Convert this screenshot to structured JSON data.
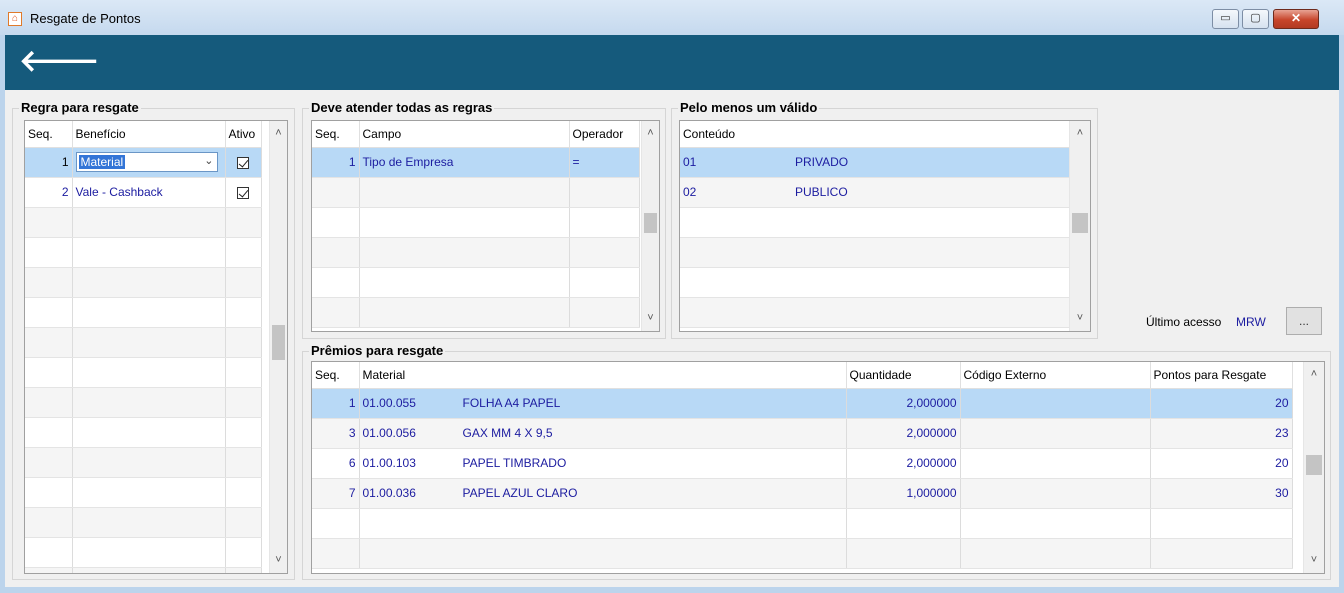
{
  "window": {
    "title": "Resgate de Pontos",
    "app_icon_glyph": "⌂",
    "min_glyph": "▭",
    "max_glyph": "▢",
    "close_glyph": "✕"
  },
  "toolbar": {
    "back_glyph": "🡐"
  },
  "regra": {
    "title": "Regra para resgate",
    "headers": {
      "seq": "Seq.",
      "beneficio": "Benefício",
      "ativo": "Ativo"
    },
    "rows": [
      {
        "seq": "1",
        "beneficio": "Material",
        "ativo": true
      },
      {
        "seq": "2",
        "beneficio": "Vale - Cashback",
        "ativo": true
      }
    ]
  },
  "deve": {
    "title": "Deve atender todas as regras",
    "headers": {
      "seq": "Seq.",
      "campo": "Campo",
      "operador": "Operador"
    },
    "rows": [
      {
        "seq": "1",
        "campo": "Tipo de Empresa",
        "operador": "="
      }
    ]
  },
  "pelo": {
    "title": "Pelo menos um válido",
    "headers": {
      "conteudo": "Conteúdo"
    },
    "rows": [
      {
        "codigo": "01",
        "descricao": "PRIVADO"
      },
      {
        "codigo": "02",
        "descricao": "PUBLICO"
      }
    ]
  },
  "ultimo_acesso": {
    "label": "Último acesso",
    "user": "MRW",
    "button": "..."
  },
  "premios": {
    "title": "Prêmios para resgate",
    "headers": {
      "seq": "Seq.",
      "material": "Material",
      "quantidade": "Quantidade",
      "codigo_externo": "Código Externo",
      "pontos": "Pontos para Resgate"
    },
    "rows": [
      {
        "seq": "1",
        "codigo": "01.00.055",
        "descricao": "FOLHA A4 PAPEL",
        "quantidade": "2,000000",
        "codigo_externo": "",
        "pontos": "20"
      },
      {
        "seq": "3",
        "codigo": "01.00.056",
        "descricao": "GAX MM 4 X 9,5",
        "quantidade": "2,000000",
        "codigo_externo": "",
        "pontos": "23"
      },
      {
        "seq": "6",
        "codigo": "01.00.103",
        "descricao": "PAPEL TIMBRADO",
        "quantidade": "2,000000",
        "codigo_externo": "",
        "pontos": "20"
      },
      {
        "seq": "7",
        "codigo": "01.00.036",
        "descricao": "PAPEL AZUL CLARO",
        "quantidade": "1,000000",
        "codigo_externo": "",
        "pontos": "30"
      }
    ]
  },
  "scroll": {
    "up": "˄",
    "down": "˅"
  }
}
